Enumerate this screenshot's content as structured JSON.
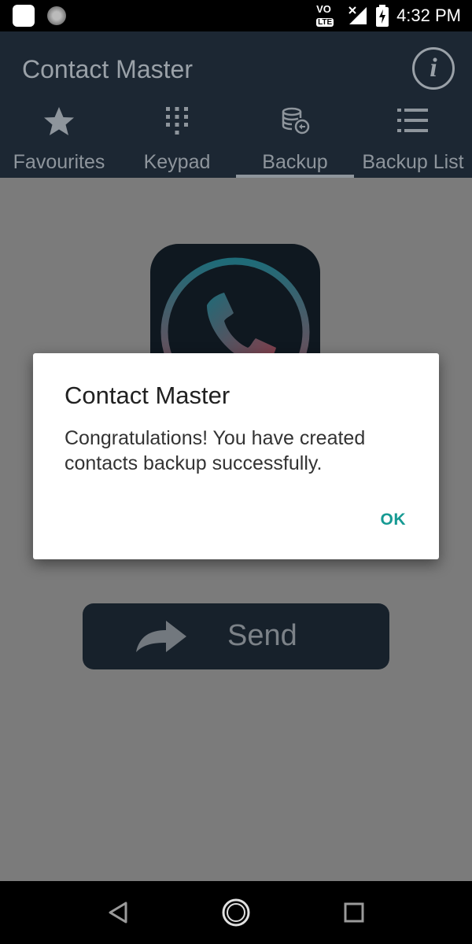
{
  "status_bar": {
    "time": "4:32 PM",
    "network_label": "LTE",
    "volte_label": "VO",
    "icons": [
      "app-notification-icon",
      "sync-icon",
      "volte-icon",
      "signal-icon",
      "battery-charging-icon"
    ]
  },
  "app_bar": {
    "title": "Contact Master",
    "info_icon": "info-icon",
    "info_glyph": "i"
  },
  "tabs": [
    {
      "label": "Favourites",
      "icon": "star-icon"
    },
    {
      "label": "Keypad",
      "icon": "keypad-icon"
    },
    {
      "label": "Backup",
      "icon": "database-backup-icon",
      "active": true
    },
    {
      "label": "Backup List",
      "icon": "list-icon"
    }
  ],
  "main": {
    "logo_icon": "phone-logo-icon",
    "send_label": "Send",
    "send_icon": "share-arrow-icon"
  },
  "dialog": {
    "title": "Contact Master",
    "message": "Congratulations! You have created contacts backup successfully.",
    "ok_label": "OK"
  },
  "nav_bar": {
    "icons": [
      "back-icon",
      "home-icon",
      "recents-icon"
    ]
  },
  "colors": {
    "app_bar": "#1c2733",
    "dim_overlay": "#7b7b7b",
    "accent": "#169a93"
  }
}
